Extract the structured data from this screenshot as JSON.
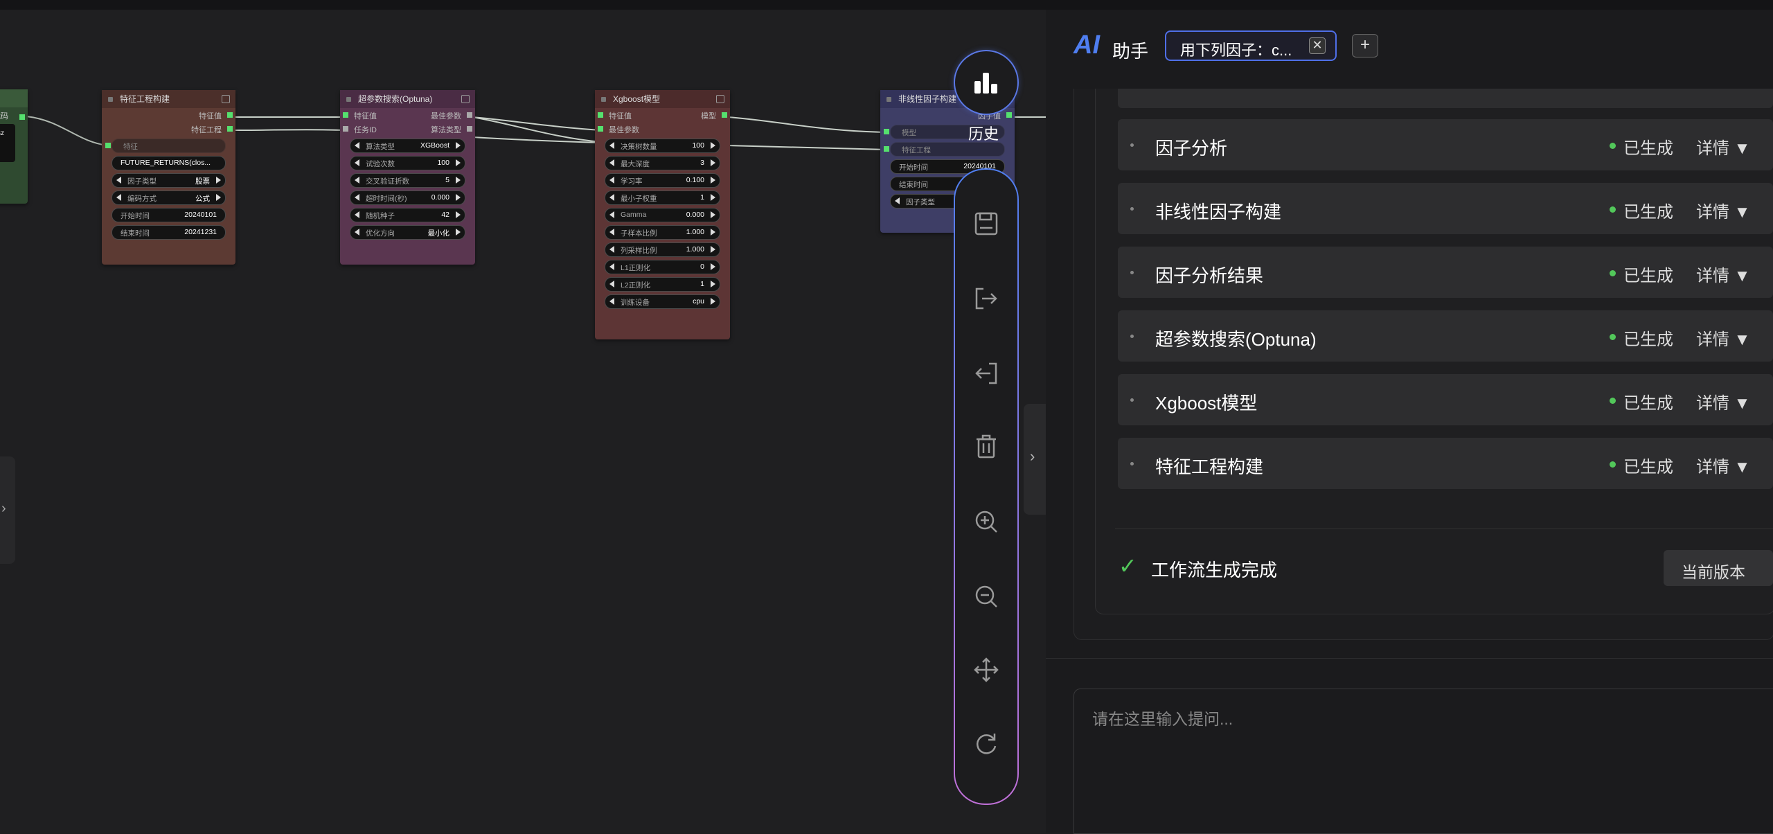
{
  "nodes": {
    "left_partial": {
      "label": "代码",
      "lines": [
        "sz",
        ")"
      ]
    },
    "feature": {
      "title": "特征工程构建",
      "out1": "特征值",
      "out2": "特征工程",
      "in1": "特征",
      "code": "FUTURE_RETURNS(clos...",
      "w1_label": "因子类型",
      "w1_value": "股票",
      "w2_label": "编码方式",
      "w2_value": "公式",
      "w3_label": "开始时间",
      "w3_value": "20240101",
      "w4_label": "结束时间",
      "w4_value": "20241231"
    },
    "optuna": {
      "title": "超参数搜索(Optuna)",
      "in1": "特征值",
      "in2": "任务ID",
      "out1": "最佳参数",
      "out2": "算法类型",
      "w1_label": "算法类型",
      "w1_value": "XGBoost",
      "w2_label": "试验次数",
      "w2_value": "100",
      "w3_label": "交叉验证折数",
      "w3_value": "5",
      "w4_label": "超时时间(秒)",
      "w4_value": "0.000",
      "w5_label": "随机种子",
      "w5_value": "42",
      "w6_label": "优化方向",
      "w6_value": "最小化"
    },
    "xgb": {
      "title": "Xgboost模型",
      "in1": "特征值",
      "in2": "最佳参数",
      "out1": "模型",
      "w1_label": "决策树数量",
      "w1_value": "100",
      "w2_label": "最大深度",
      "w2_value": "3",
      "w3_label": "学习率",
      "w3_value": "0.100",
      "w4_label": "最小子权重",
      "w4_value": "1",
      "w5_label": "Gamma",
      "w5_value": "0.000",
      "w6_label": "子样本比例",
      "w6_value": "1.000",
      "w7_label": "列采样比例",
      "w7_value": "1.000",
      "w8_label": "L1正则化",
      "w8_value": "0",
      "w9_label": "L2正则化",
      "w9_value": "1",
      "w10_label": "训练设备",
      "w10_value": "cpu"
    },
    "nonlinear": {
      "title": "非线性因子构建",
      "out1": "因子值",
      "in1": "模型",
      "in2": "特征工程",
      "w1_label": "开始时间",
      "w1_value": "20240101",
      "w2_label": "结束时间",
      "w3_label": "因子类型"
    }
  },
  "toolbar": {
    "history_label": "历史"
  },
  "assistant": {
    "logo": "AI",
    "title": "助手",
    "tab_label": "用下列因子：c...",
    "tab_close": "✕",
    "add_label": "+",
    "status_text": "已生成",
    "detail_text": "详情 ▼",
    "items": [
      {
        "name": "因子分析"
      },
      {
        "name": "非线性因子构建"
      },
      {
        "name": "因子分析结果"
      },
      {
        "name": "超参数搜索(Optuna)"
      },
      {
        "name": "Xgboost模型"
      },
      {
        "name": "特征工程构建"
      }
    ],
    "done_icon": "✓",
    "done_text": "工作流生成完成",
    "version_button": "当前版本",
    "prompt_placeholder": "请在这里输入提问..."
  },
  "colors": {
    "feature_node": "#5c3a33",
    "optuna_node": "#5a3650",
    "xgb_node": "#5d3535",
    "nonlinear_node": "#3e3e66",
    "accent": "#4f7ef0",
    "status_green": "#52c75a"
  }
}
